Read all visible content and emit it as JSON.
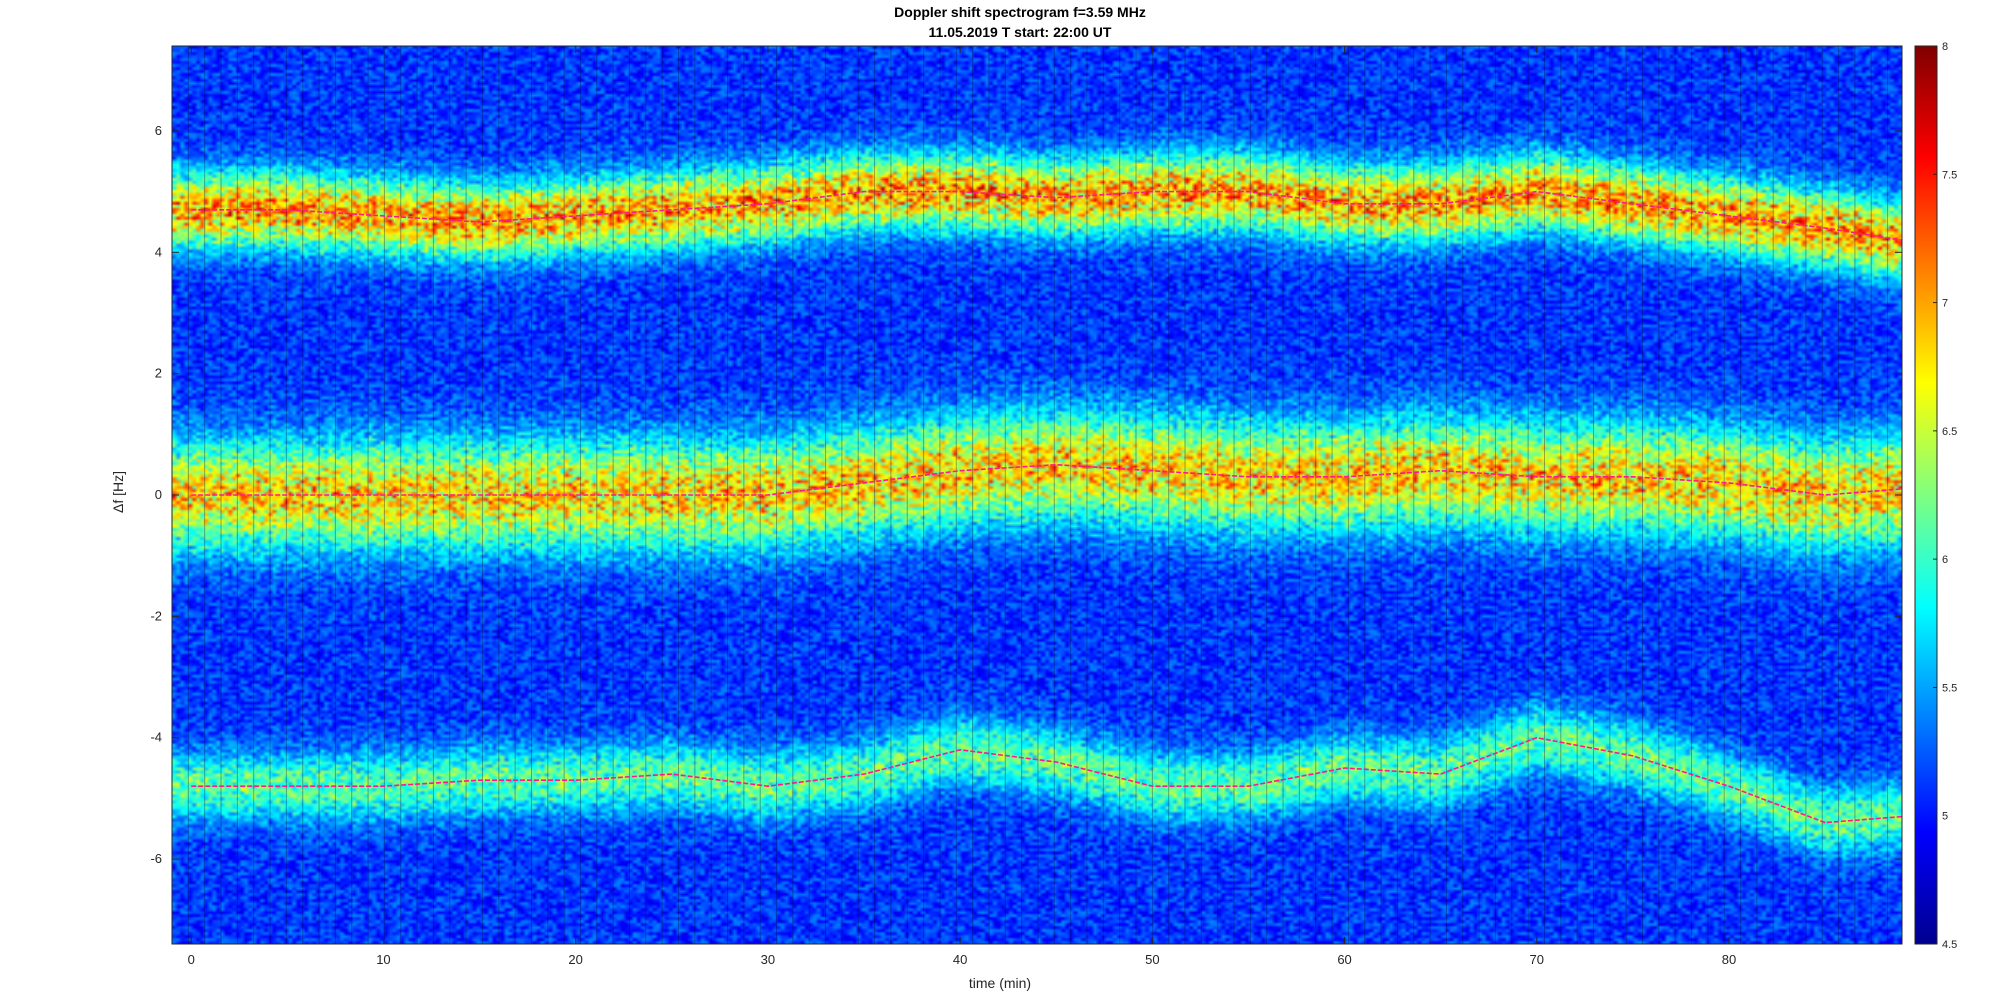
{
  "chart_data": {
    "type": "heatmap",
    "title": "Doppler shift spectrogram f=3.59 MHz",
    "subtitle": "11.05.2019    T start: 22:00 UT",
    "xlabel": "time (min)",
    "ylabel": "Δf [Hz]",
    "xlim": [
      -1,
      89
    ],
    "ylim": [
      -7.4,
      7.4
    ],
    "x_ticks": [
      "0",
      "10",
      "20",
      "30",
      "40",
      "50",
      "60",
      "70",
      "80"
    ],
    "y_ticks": [
      "-6",
      "-4",
      "-2",
      "0",
      "2",
      "4",
      "6"
    ],
    "colorbar": {
      "colormap": "jet",
      "range": [
        4.5,
        8
      ],
      "ticks": [
        "4.5",
        "5",
        "5.5",
        "6",
        "6.5",
        "7",
        "7.5",
        "8"
      ]
    },
    "series": [
      {
        "x": [
          0,
          5,
          10,
          15,
          20,
          25,
          30,
          35,
          40,
          45,
          50,
          55,
          60,
          65,
          70,
          75,
          80,
          85,
          89
        ],
        "y": [
          4.7,
          4.7,
          4.6,
          4.5,
          4.6,
          4.7,
          4.8,
          5.0,
          5.0,
          4.9,
          5.0,
          5.0,
          4.8,
          4.8,
          5.0,
          4.8,
          4.6,
          4.4,
          4.2
        ],
        "color": "#ff1a8c"
      },
      {
        "x": [
          0,
          5,
          10,
          15,
          20,
          25,
          30,
          35,
          40,
          45,
          50,
          55,
          60,
          65,
          70,
          75,
          80,
          85,
          89
        ],
        "y": [
          0.0,
          0.0,
          0.0,
          0.0,
          0.0,
          0.0,
          0.0,
          0.2,
          0.4,
          0.5,
          0.4,
          0.3,
          0.3,
          0.4,
          0.3,
          0.3,
          0.2,
          0.0,
          0.1
        ],
        "color": "#ff1a8c"
      },
      {
        "x": [
          0,
          5,
          10,
          15,
          20,
          25,
          30,
          35,
          40,
          45,
          50,
          55,
          60,
          65,
          70,
          75,
          80,
          85,
          89
        ],
        "y": [
          -4.8,
          -4.8,
          -4.8,
          -4.7,
          -4.7,
          -4.6,
          -4.8,
          -4.6,
          -4.2,
          -4.4,
          -4.8,
          -4.8,
          -4.5,
          -4.6,
          -4.0,
          -4.3,
          -4.8,
          -5.4,
          -5.3
        ],
        "color": "#ff1a8c"
      }
    ],
    "bands": [
      {
        "center": 4.75,
        "halfwidth": 0.55,
        "peak": 7.1
      },
      {
        "center": 0.1,
        "halfwidth": 0.8,
        "peak": 6.9
      },
      {
        "center": -4.6,
        "halfwidth": 0.5,
        "peak": 6.1
      }
    ]
  }
}
